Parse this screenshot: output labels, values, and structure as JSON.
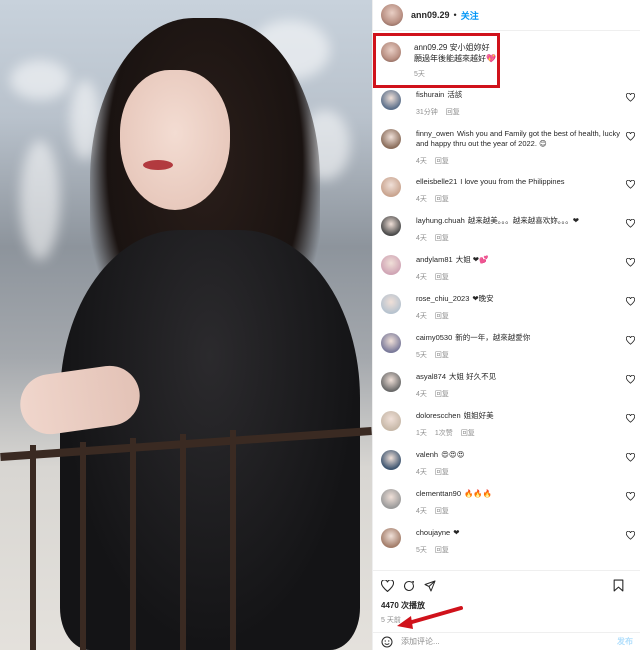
{
  "post": {
    "username": "ann09.29",
    "separator": "•",
    "follow_label": "关注"
  },
  "caption": {
    "username": "ann09.29",
    "text_line1": "安小姐妳好",
    "text_line2": "願過年後能越來越好",
    "emoji": "💖",
    "time": "5天"
  },
  "comments": [
    {
      "user": "fishurain",
      "text": "活該",
      "meta": [
        "31分钟",
        "回复"
      ]
    },
    {
      "user": "finny_owen",
      "text": "Wish you and Family got the best of health, lucky and happy thru out the year of 2022. 😊",
      "meta": [
        "4天",
        "回复"
      ]
    },
    {
      "user": "elleisbelle21",
      "text": "I love youu from the Philippines",
      "meta": [
        "4天",
        "回复"
      ]
    },
    {
      "user": "layhung.chuah",
      "text": "越来越美。。。越来越喜欢妳。。。❤",
      "meta": [
        "4天",
        "回复"
      ]
    },
    {
      "user": "andylam81",
      "text": "大姐 ❤💕",
      "meta": [
        "4天",
        "回复"
      ]
    },
    {
      "user": "rose_chiu_2023",
      "text": "❤晚安",
      "meta": [
        "4天",
        "回复"
      ]
    },
    {
      "user": "caimy0530",
      "text": "新的一年，越來越愛你",
      "meta": [
        "5天",
        "回复"
      ]
    },
    {
      "user": "asyal874",
      "text": "大姐 好久不见",
      "meta": [
        "4天",
        "回复"
      ]
    },
    {
      "user": "dolorescchen",
      "text": "姐姐好美",
      "meta": [
        "1天",
        "1次赞",
        "回复"
      ]
    },
    {
      "user": "valenh",
      "text": "😍😍😍",
      "meta": [
        "4天",
        "回复"
      ]
    },
    {
      "user": "clementtan90",
      "text": "🔥🔥🔥",
      "meta": [
        "4天",
        "回复"
      ]
    },
    {
      "user": "choujayne",
      "text": "❤",
      "meta": [
        "5天",
        "回复"
      ]
    }
  ],
  "footer": {
    "views": "4470 次播放",
    "time": "5 天前",
    "add_comment_placeholder": "添加评论...",
    "post_label": "发布"
  },
  "colors": {
    "accent": "#0095f6",
    "highlight_red": "#d0121b",
    "meta_gray": "#8e8e8e"
  }
}
